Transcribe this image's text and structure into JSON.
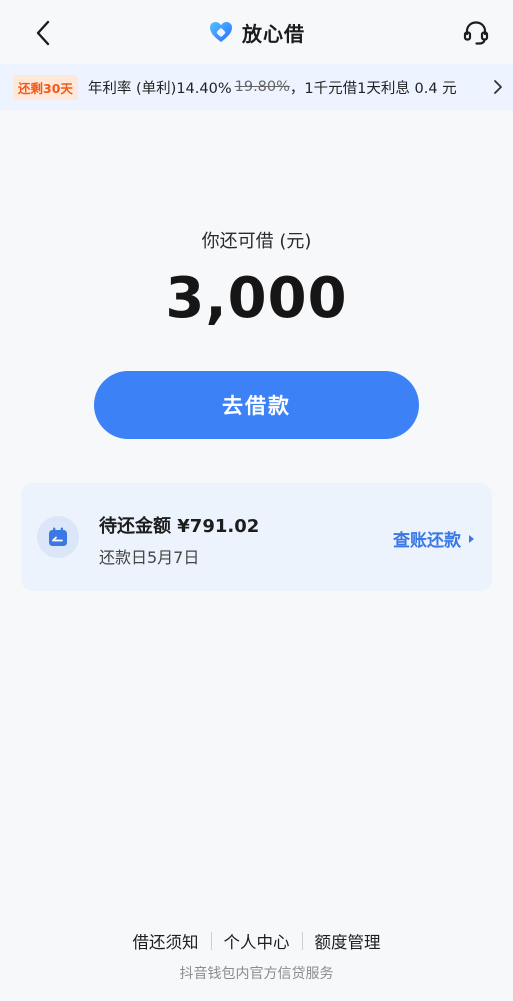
{
  "header": {
    "brand_name": "放心借",
    "back_icon": "chevron-left-icon",
    "service_icon": "headset-icon"
  },
  "promo": {
    "badge": "还剩30天",
    "rate_label": "年利率 (单利)14.40%",
    "old_rate": "19.80%",
    "interest_text": "，1千元借1天利息 0.4 元"
  },
  "credit": {
    "label": "你还可借 (元)",
    "amount": "3,000",
    "borrow_button": "去借款"
  },
  "repayment": {
    "title": "待还金额 ¥791.02",
    "due_date": "还款日5月7日",
    "action": "查账还款",
    "icon": "calendar-icon"
  },
  "footer": {
    "links": [
      "借还须知",
      "个人中心",
      "额度管理"
    ],
    "note": "抖音钱包内官方信贷服务"
  },
  "colors": {
    "accent": "#3c82f6",
    "link": "#3a78e6",
    "badge_text": "#f05a1a",
    "badge_bg": "#ffe8d9",
    "banner_bg": "#eef4ff",
    "card_bg": "#edf3fd"
  }
}
